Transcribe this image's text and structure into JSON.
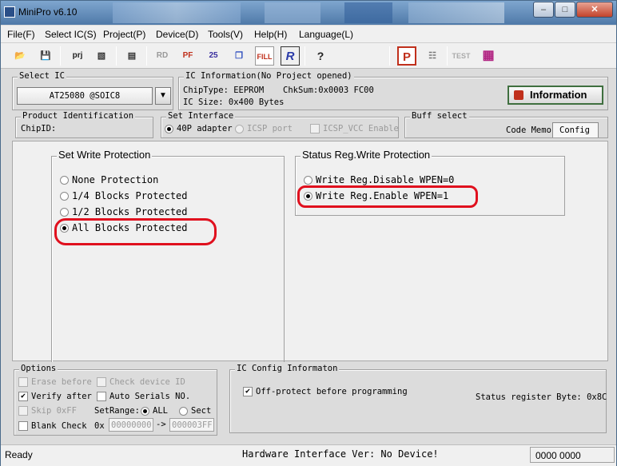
{
  "app": {
    "title": "MiniPro v6.10"
  },
  "window_buttons": {
    "minimize": "–",
    "maximize": "□",
    "close": "✕"
  },
  "menu": [
    "File(F)",
    "Select IC(S)",
    "Project(P)",
    "Device(D)",
    "Tools(V)",
    "Help(H)",
    "Language(L)"
  ],
  "toolbar": {
    "buttons": [
      {
        "name": "open-icon",
        "glyph": "📂"
      },
      {
        "name": "save-icon",
        "glyph": "💾"
      },
      {
        "name": "open-project-icon",
        "glyph": "prj"
      },
      {
        "name": "save-project-icon",
        "glyph": "▧"
      },
      {
        "name": "chip-save-icon",
        "glyph": "▤"
      },
      {
        "name": "read-icon",
        "glyph": "RD"
      },
      {
        "name": "program-icon",
        "glyph": "PF"
      },
      {
        "name": "verify-icon",
        "glyph": "25"
      },
      {
        "name": "blank-check-icon",
        "glyph": "❐"
      },
      {
        "name": "fill-icon",
        "glyph": "FILL"
      },
      {
        "name": "edit-icon",
        "glyph": "R"
      },
      {
        "name": "help-icon",
        "glyph": "?"
      },
      {
        "name": "protect-icon",
        "glyph": "P"
      },
      {
        "name": "notepad-icon",
        "glyph": "☷"
      },
      {
        "name": "test-icon",
        "glyph": "TEST"
      },
      {
        "name": "chip-icon",
        "glyph": "▦"
      }
    ]
  },
  "select_ic": {
    "label": "Select IC",
    "value": "AT25080 @SOIC8"
  },
  "ic_info": {
    "label": "IC Information(No Project opened)",
    "chip_type": "ChipType:  EEPROM",
    "chksum": "ChkSum:0x0003 FC00",
    "ic_size": "IC Size:   0x400 Bytes",
    "information_button": "Information"
  },
  "product_id": {
    "label": "Product Identification",
    "chip_id": "ChipID:"
  },
  "set_interface": {
    "label": "Set Interface",
    "opt_40p": "40P adapter",
    "opt_icsp": "ICSP port",
    "icsp_vcc": "ICSP_VCC Enable"
  },
  "buff_select": {
    "label": "Buff select",
    "code_memo": "Code Memo",
    "config": "Config"
  },
  "write_protection": {
    "title": "Set Write Protection",
    "options": [
      "None Protection",
      "1/4 Blocks Protected",
      "1/2 Blocks Protected",
      "All Blocks Protected"
    ],
    "selected": 3
  },
  "status_reg": {
    "title": "Status Reg.Write Protection",
    "options": [
      "Write Reg.Disable WPEN=0",
      "Write Reg.Enable WPEN=1"
    ],
    "selected": 1
  },
  "options": {
    "label": "Options",
    "erase_before": "Erase before",
    "check_device_id": "Check device ID",
    "verify_after": "Verify after",
    "auto_serials": "Auto Serials NO.",
    "skip_0xff": "Skip 0xFF",
    "set_range": "SetRange:",
    "all": "ALL",
    "sect": "Sect",
    "blank_check": "Blank Check",
    "ox": "0x",
    "range_from": "00000000",
    "arrow": "->",
    "range_to": "000003FF"
  },
  "ic_config": {
    "label": "IC Config Informaton",
    "off_protect": "Off-protect before programming",
    "status_byte": "Status register Byte: 0x8C"
  },
  "status_bar": {
    "ready": "Ready",
    "hw": "Hardware Interface Ver: No Device!",
    "counter": "0000 0000"
  },
  "colors": {
    "annotation_red": "#e0101e",
    "title_bar": "#5b84b3"
  }
}
